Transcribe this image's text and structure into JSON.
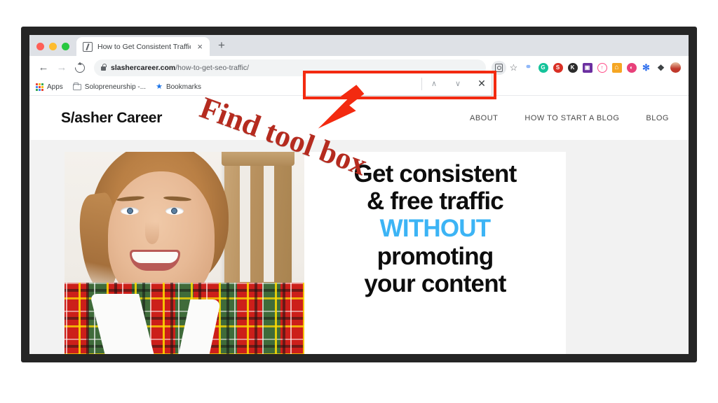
{
  "browser": {
    "traffic_lights": [
      "close",
      "minimize",
      "maximize"
    ],
    "tab": {
      "title": "How to Get Consistent Traffic |",
      "favicon": "slash-box-favicon",
      "close_label": "×"
    },
    "new_tab_label": "+",
    "toolbar": {
      "back_label": "←",
      "forward_label": "→",
      "reload_name": "reload-icon",
      "url_domain": "slashercareer.com",
      "url_path": "/how-to-get-seo-traffic/",
      "lock_name": "secure-lock-icon",
      "bookmark_star_label": "☆",
      "extensions": [
        {
          "name": "link-extension-icon",
          "glyph": "⚭",
          "color": "#8ab4f8",
          "bg": "transparent",
          "text": "#8ab4f8"
        },
        {
          "name": "grammarly-extension-icon",
          "glyph": "G",
          "color": "#15c39a",
          "bg": "#15c39a",
          "text": "#ffffff"
        },
        {
          "name": "seo-extension-icon",
          "glyph": "S",
          "color": "#d93025",
          "bg": "#d93025",
          "text": "#ffffff"
        },
        {
          "name": "k-extension-icon",
          "glyph": "K",
          "color": "#2b2b2b",
          "bg": "#2b2b2b",
          "text": "#ffffff"
        },
        {
          "name": "purple-box-extension-icon",
          "glyph": "▣",
          "color": "#6b2fa0",
          "bg": "#6b2fa0",
          "text": "#ffffff"
        },
        {
          "name": "upload-circle-extension-icon",
          "glyph": "↑",
          "color": "#ff4d88",
          "bg": "transparent",
          "text": "#ff4d88"
        },
        {
          "name": "home-extension-icon",
          "glyph": "⌂",
          "color": "#f5a623",
          "bg": "#f5a623",
          "text": "#ffffff"
        },
        {
          "name": "pink-circle-extension-icon",
          "glyph": "◐",
          "color": "#e8407a",
          "bg": "#e8407a",
          "text": "#ffffff"
        },
        {
          "name": "gear-extension-icon",
          "glyph": "✻",
          "color": "#2f6fed",
          "bg": "transparent",
          "text": "#2f6fed"
        },
        {
          "name": "puzzle-extensions-icon",
          "glyph": "❖",
          "color": "#3c4043",
          "bg": "transparent",
          "text": "#3c4043"
        }
      ],
      "profile_avatar_name": "profile-avatar"
    },
    "bookmarks": [
      {
        "label": "Apps",
        "icon": "apps-grid-icon"
      },
      {
        "label": "Solopreneurship -...",
        "icon": "folder-icon"
      },
      {
        "label": "Bookmarks",
        "icon": "star-icon"
      }
    ]
  },
  "findbar": {
    "input_value": "",
    "placeholder": "",
    "prev_label": "∧",
    "next_label": "∨",
    "close_label": "✕"
  },
  "annotation": {
    "text": "Find tool box",
    "color": "#b52b1f",
    "box_color": "#f32a10",
    "arrow_name": "annotation-arrow"
  },
  "site": {
    "logo": "S/asher Career",
    "menu": [
      "ABOUT",
      "HOW TO START A BLOG",
      "BLOG"
    ],
    "hero": {
      "line1": "Get consistent",
      "line2": "& free traffic",
      "line3": "WITHOUT",
      "line4": "promoting",
      "line5": "your content",
      "highlight_color": "#3cb4f5",
      "photo_alt": "smiling-woman-in-tartan-blazer"
    }
  }
}
